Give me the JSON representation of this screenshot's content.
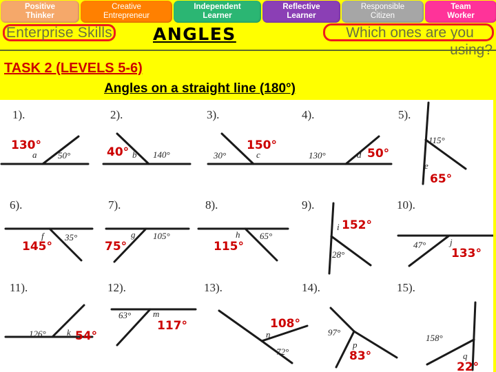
{
  "skills_bar": {
    "tabs": [
      {
        "id": "positive-thinker",
        "line1": "Positive",
        "line2": "Thinker",
        "color": "#f5a86a"
      },
      {
        "id": "creative-entrepreneur",
        "line1": "Creative",
        "line2": "Entrepreneur",
        "color": "#ff8000"
      },
      {
        "id": "independent-learner",
        "line1": "Independent",
        "line2": "Learner",
        "color": "#2bb673"
      },
      {
        "id": "reflective-learner",
        "line1": "Reflective",
        "line2": "Learner",
        "color": "#8b3fb5"
      },
      {
        "id": "responsible-citizen",
        "line1": "Responsible",
        "line2": "Citizen",
        "color": "#a6a6a6"
      },
      {
        "id": "team-worker",
        "line1": "Team",
        "line2": "Worker",
        "color": "#ff3399"
      }
    ]
  },
  "header": {
    "enterprise_label": "Enterprise Skills",
    "title": "ANGLES",
    "question_line1": "Which ones are you",
    "question_line2": "using?",
    "task_label": "TASK 2 (LEVELS 5-6)",
    "subtitle": "Angles on a straight line (180°)",
    "band_color": "#ffff00",
    "box_color": "#ee1c1c",
    "task_color": "#cc0000",
    "muted_text_color": "#6b7040"
  },
  "worksheet": {
    "answer_color": "#cc0000",
    "problems": [
      {
        "number": "1).",
        "given": "50°",
        "unknown": "a",
        "answer": "130°"
      },
      {
        "number": "2).",
        "given": "140°",
        "unknown": "b",
        "answer": "40°"
      },
      {
        "number": "3).",
        "given": "30°",
        "unknown": "c",
        "answer": "150°"
      },
      {
        "number": "4).",
        "given": "130°",
        "unknown": "d",
        "answer": "50°"
      },
      {
        "number": "5).",
        "given": "115°",
        "unknown": "e",
        "answer": "65°"
      },
      {
        "number": "6).",
        "given": "35°",
        "unknown": "f",
        "answer": "145°"
      },
      {
        "number": "7).",
        "given": "105°",
        "unknown": "g",
        "answer": "75°"
      },
      {
        "number": "8).",
        "given": "65°",
        "unknown": "h",
        "answer": "115°"
      },
      {
        "number": "9).",
        "given": "28°",
        "unknown": "i",
        "answer": "152°"
      },
      {
        "number": "10).",
        "given": "47°",
        "unknown": "j",
        "answer": "133°"
      },
      {
        "number": "11).",
        "given": "126°",
        "unknown": "k",
        "answer": "54°"
      },
      {
        "number": "12).",
        "given": "63°",
        "unknown": "m",
        "answer": "117°"
      },
      {
        "number": "13).",
        "given": "72°",
        "unknown": "n",
        "answer": "108°"
      },
      {
        "number": "14).",
        "given": "97°",
        "unknown": "p",
        "answer": "83°"
      },
      {
        "number": "15).",
        "given": "158°",
        "unknown": "q",
        "answer": "22°"
      }
    ]
  }
}
